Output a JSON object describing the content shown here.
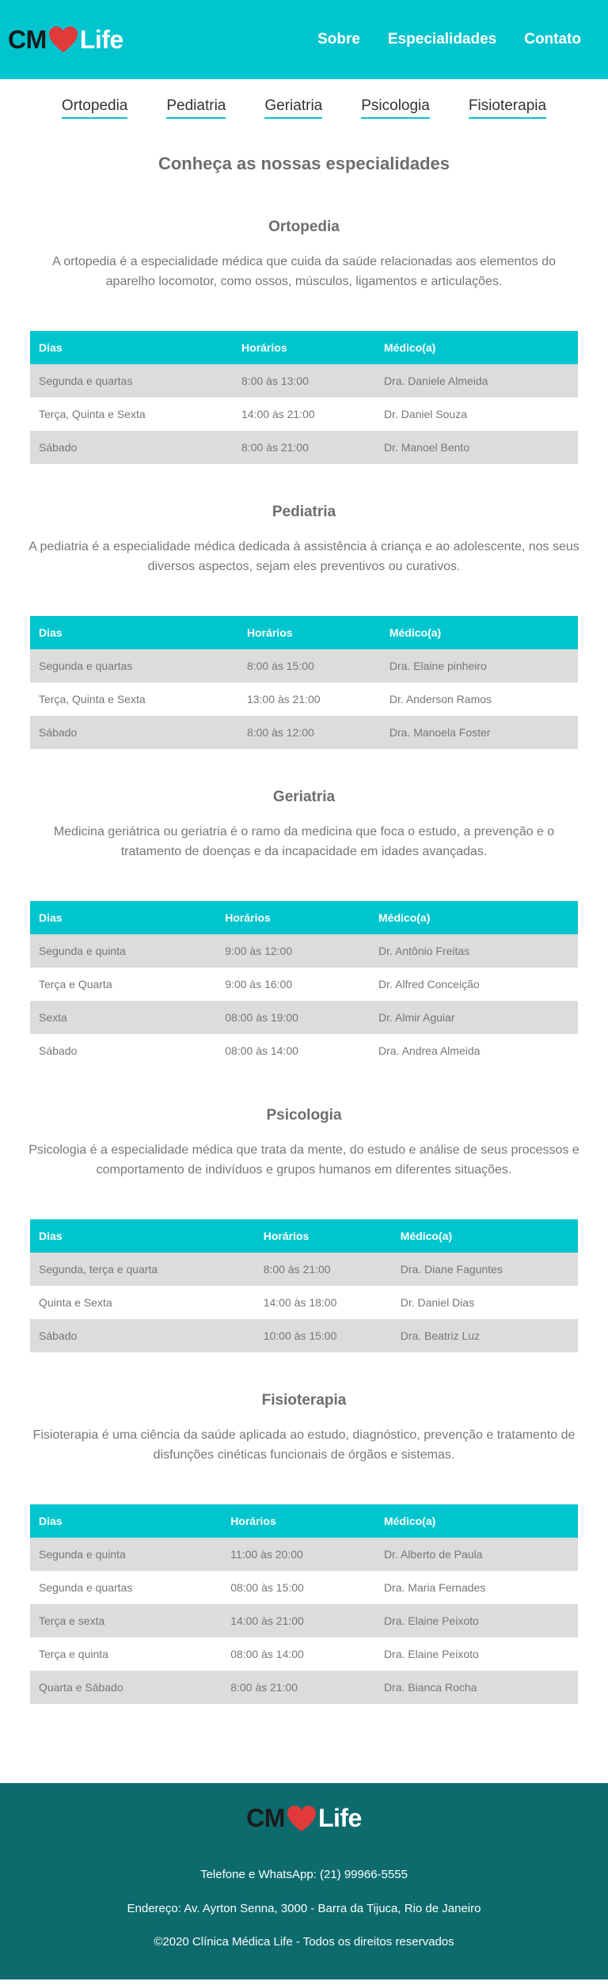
{
  "brand": {
    "prefix": "CM",
    "suffix": "Life",
    "heart_color": "#e03a3a"
  },
  "colors": {
    "accent": "#00c5ce",
    "footer": "#0d6b6e",
    "stripe": "#dcdcdc"
  },
  "nav": [
    "Sobre",
    "Especialidades",
    "Contato"
  ],
  "subnav": [
    "Ortopedia",
    "Pediatria",
    "Geriatria",
    "Psicologia",
    "Fisioterapia"
  ],
  "main_title": "Conheça as nossas especialidades",
  "table_headers": [
    "Dias",
    "Horários",
    "Médico(a)"
  ],
  "sections": [
    {
      "title": "Ortopedia",
      "description": "A ortopedia é a especialidade médica que cuida da saúde relacionadas aos elementos do aparelho locomotor, como ossos, músculos, ligamentos e articulações.",
      "rows": [
        [
          "Segunda e quartas",
          "8:00 às 13:00",
          "Dra. Daniele Almeida"
        ],
        [
          "Terça, Quinta e Sexta",
          "14:00 às 21:00",
          "Dr. Daniel Souza"
        ],
        [
          "Sábado",
          "8:00 às 21:00",
          "Dr. Manoel Bento"
        ]
      ]
    },
    {
      "title": "Pediatria",
      "description": "A pediatria é a especialidade médica dedicada à assistência à criança e ao adolescente, nos seus diversos aspectos, sejam eles preventivos ou curativos.",
      "rows": [
        [
          "Segunda e quartas",
          "8:00 às 15:00",
          "Dra. Elaine pinheiro"
        ],
        [
          "Terça, Quinta e Sexta",
          "13:00 às 21:00",
          "Dr. Anderson Ramos"
        ],
        [
          "Sábado",
          "8:00 às 12:00",
          "Dra. Manoela Foster"
        ]
      ]
    },
    {
      "title": "Geriatria",
      "description": "Medicina geriátrica ou geriatria é o ramo da medicina que foca o estudo, a prevenção e o tratamento de doenças e da incapacidade em idades avançadas.",
      "rows": [
        [
          "Segunda e quinta",
          "9:00 às 12:00",
          "Dr. Antônio Freitas"
        ],
        [
          "Terça e Quarta",
          "9:00 às 16:00",
          "Dr. Alfred Conceição"
        ],
        [
          "Sexta",
          "08:00 às 19:00",
          "Dr. Almir Aguiar"
        ],
        [
          "Sábado",
          "08:00 às 14:00",
          "Dra. Andrea Almeida"
        ]
      ]
    },
    {
      "title": "Psicologia",
      "description": "Psicologia é a especialidade médica que trata da mente, do estudo e análise de seus processos e comportamento de indivíduos e grupos humanos em diferentes situações.",
      "rows": [
        [
          "Segunda, terça e quarta",
          "8:00 às 21:00",
          "Dra. Diane Faguntes"
        ],
        [
          "Quinta e Sexta",
          "14:00 às 18:00",
          "Dr. Daniel Dias"
        ],
        [
          "Sábado",
          "10:00 às 15:00",
          "Dra. Beatriz Luz"
        ]
      ]
    },
    {
      "title": "Fisioterapia",
      "description": "Fisioterapia é uma ciência da saúde aplicada ao estudo, diagnóstico, prevenção e tratamento de disfunções cinéticas funcionais de órgãos e sistemas.",
      "rows": [
        [
          "Segunda e quinta",
          "11:00 às 20:00",
          "Dr. Alberto de Paula"
        ],
        [
          "Segunda e quartas",
          "08:00 às 15:00",
          "Dra. Maria Fernades"
        ],
        [
          "Terça e sexta",
          "14:00 às 21:00",
          "Dra. Elaine Peixoto"
        ],
        [
          "Terça e quinta",
          "08:00 às 14:00",
          "Dra. Elaine Peixoto"
        ],
        [
          "Quarta e Sábado",
          "8:00 às 21:00",
          "Dra. Bianca Rocha"
        ]
      ]
    }
  ],
  "footer": {
    "phone": "Telefone e WhatsApp: (21) 99966-5555",
    "address": "Endereço: Av. Ayrton Senna, 3000 - Barra da Tijuca, Rio de Janeiro",
    "copyright": "©2020 Clínica Médica Life - Todos os direitos reservados"
  }
}
